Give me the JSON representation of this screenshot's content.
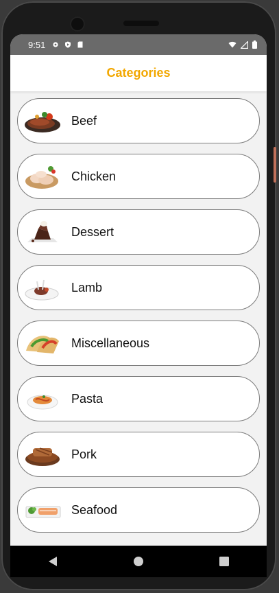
{
  "status": {
    "time": "9:51"
  },
  "appbar": {
    "title": "Categories"
  },
  "categories": [
    {
      "label": "Beef"
    },
    {
      "label": "Chicken"
    },
    {
      "label": "Dessert"
    },
    {
      "label": "Lamb"
    },
    {
      "label": "Miscellaneous"
    },
    {
      "label": "Pasta"
    },
    {
      "label": "Pork"
    },
    {
      "label": "Seafood"
    }
  ],
  "colors": {
    "accent": "#f2a700",
    "statusbar": "#6a6a6a",
    "background": "#f2f2f2"
  },
  "nav": {
    "icons": [
      "back-icon",
      "home-icon",
      "recents-icon"
    ]
  }
}
